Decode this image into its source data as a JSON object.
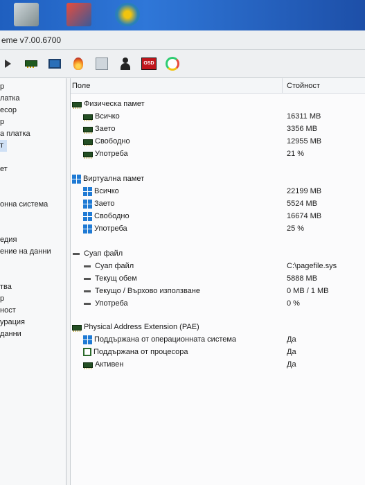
{
  "window": {
    "title": "eme v7.00.6700"
  },
  "toolbar": {
    "buttons": [
      {
        "name": "forward-arrow-icon"
      },
      {
        "name": "memory-icon"
      },
      {
        "name": "monitor-icon"
      },
      {
        "name": "flame-icon"
      },
      {
        "name": "tools-icon"
      },
      {
        "name": "user-icon"
      },
      {
        "name": "osd-icon",
        "label": "OSD"
      },
      {
        "name": "gauge-icon"
      }
    ]
  },
  "tree": {
    "items": [
      "р",
      "латка",
      "есор",
      "р",
      "а платка",
      "т",
      "",
      "ет",
      "",
      "",
      "онна система",
      "",
      "",
      "едия",
      "ение на данни",
      "",
      "",
      "тва",
      "р",
      "ност",
      "урация",
      "данни"
    ]
  },
  "columns": {
    "field": "Поле",
    "value": "Стойност"
  },
  "sections": {
    "physical": {
      "title": "Физическа памет",
      "rows": [
        {
          "label": "Всичко",
          "value": "16311 MB"
        },
        {
          "label": "Заето",
          "value": "3356 MB"
        },
        {
          "label": "Свободно",
          "value": "12955 MB"
        },
        {
          "label": "Употреба",
          "value": "21 %"
        }
      ]
    },
    "virtual": {
      "title": "Виртуална памет",
      "rows": [
        {
          "label": "Всичко",
          "value": "22199 MB"
        },
        {
          "label": "Заето",
          "value": "5524 MB"
        },
        {
          "label": "Свободно",
          "value": "16674 MB"
        },
        {
          "label": "Употреба",
          "value": "25 %"
        }
      ]
    },
    "swap": {
      "title": "Суап файл",
      "rows": [
        {
          "label": "Суап файл",
          "value": "C:\\pagefile.sys"
        },
        {
          "label": "Текущ обем",
          "value": "5888 MB"
        },
        {
          "label": "Текущо / Върхово използване",
          "value": "0 MB / 1 MB"
        },
        {
          "label": "Употреба",
          "value": "0 %"
        }
      ]
    },
    "pae": {
      "title": "Physical Address Extension (PAE)",
      "rows": [
        {
          "label": "Поддържана от операционната система",
          "value": "Да"
        },
        {
          "label": "Поддържана от процесора",
          "value": "Да"
        },
        {
          "label": "Активен",
          "value": "Да"
        }
      ]
    }
  }
}
